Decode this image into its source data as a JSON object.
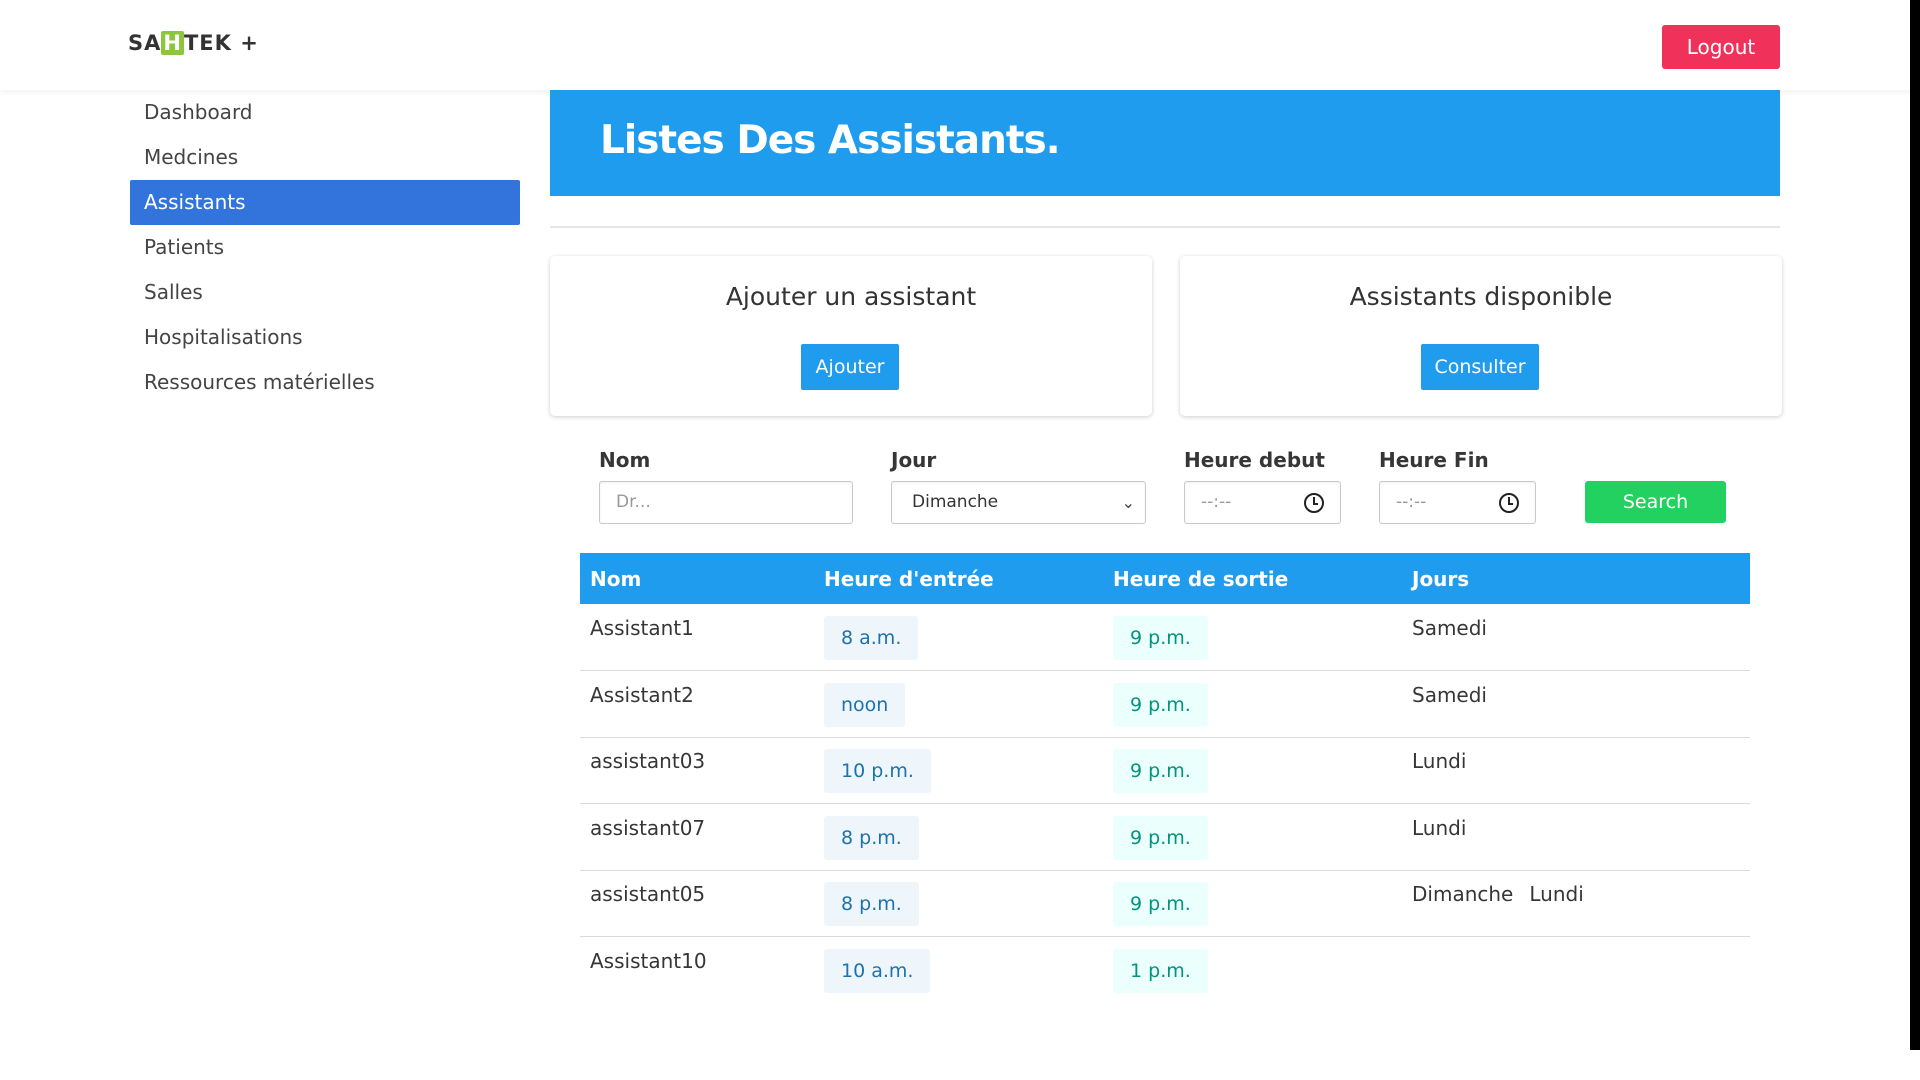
{
  "header": {
    "logo_pre": "SA",
    "logo_hl": "H",
    "logo_post": "TEK +",
    "logout_label": "Logout"
  },
  "sidebar": {
    "items": [
      {
        "label": "Dashboard",
        "active": false
      },
      {
        "label": "Medcines",
        "active": false
      },
      {
        "label": "Assistants",
        "active": true
      },
      {
        "label": "Patients",
        "active": false
      },
      {
        "label": "Salles",
        "active": false
      },
      {
        "label": "Hospitalisations",
        "active": false
      },
      {
        "label": "Ressources matérielles",
        "active": false
      }
    ]
  },
  "main": {
    "title": "Listes Des Assistants.",
    "cards": [
      {
        "title": "Ajouter un assistant",
        "button": "Ajouter"
      },
      {
        "title": "Assistants disponible",
        "button": "Consulter"
      }
    ],
    "filters": {
      "nom_label": "Nom",
      "nom_placeholder": "Dr...",
      "jour_label": "Jour",
      "jour_value": "Dimanche",
      "debut_label": "Heure debut",
      "debut_value": "--:--",
      "fin_label": "Heure Fin",
      "fin_value": "--:--",
      "search_label": "Search"
    },
    "table": {
      "columns": [
        "Nom",
        "Heure d'entrée",
        "Heure de sortie",
        "Jours"
      ],
      "rows": [
        {
          "nom": "Assistant1",
          "entree": "8 a.m.",
          "sortie": "9 p.m.",
          "jours": [
            "Samedi"
          ]
        },
        {
          "nom": "Assistant2",
          "entree": "noon",
          "sortie": "9 p.m.",
          "jours": [
            "Samedi"
          ]
        },
        {
          "nom": "assistant03",
          "entree": "10 p.m.",
          "sortie": "9 p.m.",
          "jours": [
            "Lundi"
          ]
        },
        {
          "nom": "assistant07",
          "entree": "8 p.m.",
          "sortie": "9 p.m.",
          "jours": [
            "Lundi"
          ]
        },
        {
          "nom": "assistant05",
          "entree": "8 p.m.",
          "sortie": "9 p.m.",
          "jours": [
            "Dimanche",
            "Lundi"
          ]
        },
        {
          "nom": "Assistant10",
          "entree": "10 a.m.",
          "sortie": "1 p.m.",
          "jours": []
        }
      ]
    }
  }
}
